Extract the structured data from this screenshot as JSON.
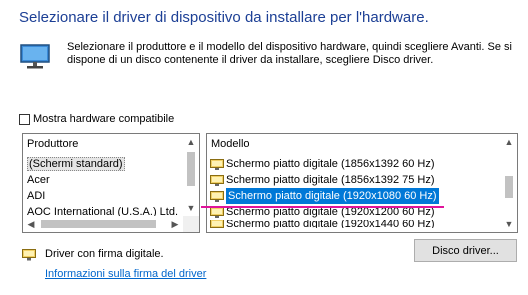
{
  "heading": "Selezionare il driver di dispositivo da installare per l'hardware.",
  "description": "Selezionare il produttore e il modello del dispositivo hardware, quindi scegliere Avanti. Se si dispone di un disco contenente il driver da installare, scegliere Disco driver.",
  "compatible_checkbox": {
    "label": "Mostra hardware compatibile",
    "checked": false
  },
  "manufacturer_list": {
    "header": "Produttore",
    "items": [
      "(Schermi standard)",
      "Acer",
      "ADI",
      "AOC International (U.S.A.) Ltd."
    ],
    "selected": "(Schermi standard)"
  },
  "model_list": {
    "header": "Modello",
    "items": [
      "Schermo piatto digitale (1856x1392 60 Hz)",
      "Schermo piatto digitale (1856x1392 75 Hz)",
      "Schermo piatto digitale (1920x1080 60 Hz)",
      "Schermo piatto digitale (1920x1200 60 Hz)",
      "Schermo piatto digitale (1920x1440 60 Hz)"
    ],
    "selected": "Schermo piatto digitale (1920x1080 60 Hz)"
  },
  "signature": {
    "text": "Driver con firma digitale.",
    "link": "Informazioni sulla firma del driver"
  },
  "disk_button": "Disco driver...",
  "icons": {
    "monitor": "monitor-icon",
    "signed": "signed-driver-icon"
  },
  "colors": {
    "heading": "#1c3f95",
    "selection": "#0078d7",
    "link": "#0066cc",
    "annotation_line": "#e0139b"
  }
}
